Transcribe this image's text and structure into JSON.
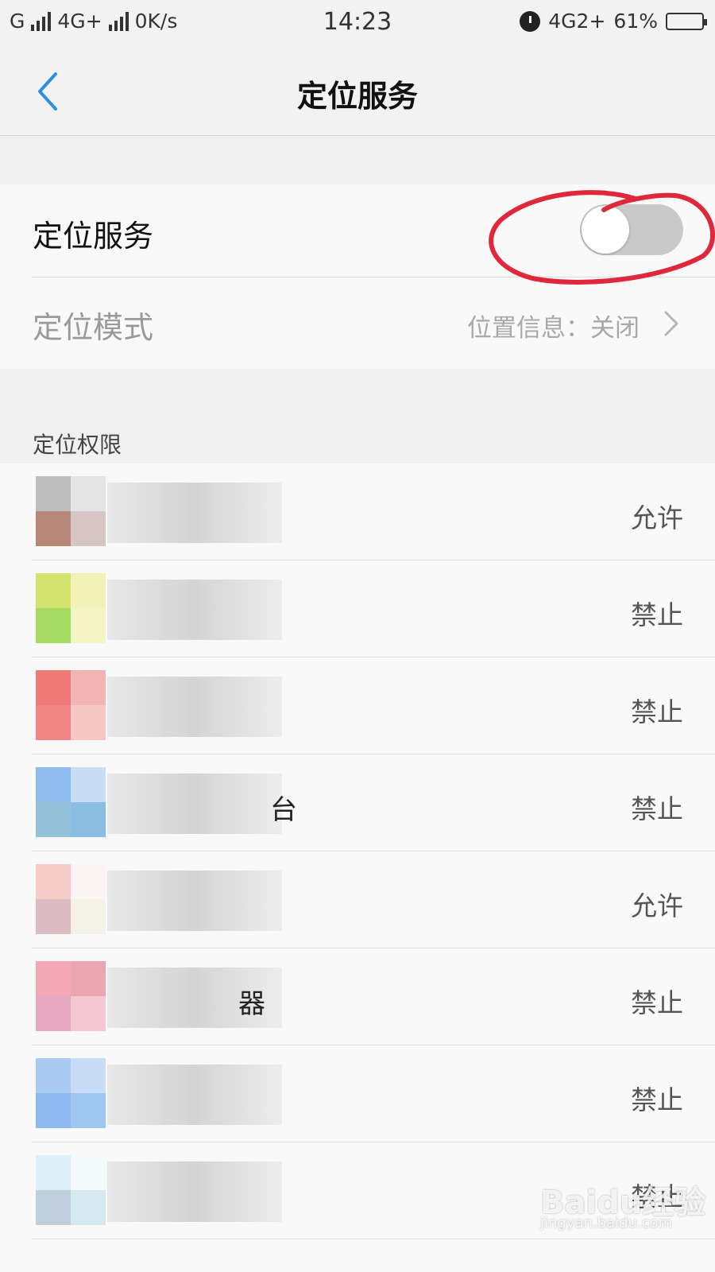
{
  "status_bar": {
    "carrier1": "G",
    "carrier2": "4G+",
    "speed": "0K/s",
    "time": "14:23",
    "network": "4G2+",
    "battery_percent": "61%",
    "battery_level": 0.61,
    "battery_color": "#f6c400"
  },
  "header": {
    "back_icon": "chevron-left-icon",
    "title": "定位服务",
    "accent_color": "#2a8fe0"
  },
  "location_service": {
    "label": "定位服务",
    "toggle_on": false
  },
  "location_mode": {
    "label": "定位模式",
    "value": "位置信息：关闭"
  },
  "permissions": {
    "section_label": "定位权限",
    "apps": [
      {
        "name": "",
        "status": "允许"
      },
      {
        "name": "",
        "status": "禁止"
      },
      {
        "name": "",
        "status": "禁止"
      },
      {
        "name": "台",
        "status": "禁止"
      },
      {
        "name": "",
        "status": "允许"
      },
      {
        "name": "器",
        "status": "禁止"
      },
      {
        "name": "",
        "status": "禁止"
      },
      {
        "name": "",
        "status": "禁止"
      }
    ]
  },
  "watermark": {
    "brand": "Baidu经验",
    "url": "jingyan.baidu.com"
  }
}
